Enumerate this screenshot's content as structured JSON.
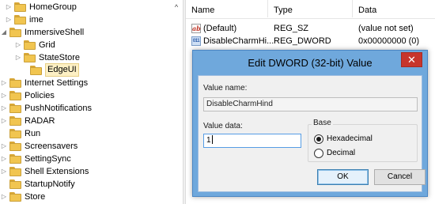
{
  "tree": {
    "items": [
      {
        "label": "HomeGroup",
        "expander": "▷"
      },
      {
        "label": "ime",
        "expander": "▷"
      },
      {
        "label": "ImmersiveShell",
        "expander": "◢"
      },
      {
        "label": "Grid",
        "expander": "▷"
      },
      {
        "label": "StateStore",
        "expander": "▷"
      },
      {
        "label": "EdgeUI",
        "expander": ""
      },
      {
        "label": "Internet Settings",
        "expander": "▷"
      },
      {
        "label": "Policies",
        "expander": "▷"
      },
      {
        "label": "PushNotifications",
        "expander": "▷"
      },
      {
        "label": "RADAR",
        "expander": "▷"
      },
      {
        "label": "Run",
        "expander": ""
      },
      {
        "label": "Screensavers",
        "expander": "▷"
      },
      {
        "label": "SettingSync",
        "expander": "▷"
      },
      {
        "label": "Shell Extensions",
        "expander": "▷"
      },
      {
        "label": "StartupNotify",
        "expander": ""
      },
      {
        "label": "Store",
        "expander": "▷"
      }
    ],
    "selected": "EdgeUI",
    "scroll_up_icon": "^"
  },
  "list": {
    "columns": {
      "name": "Name",
      "type": "Type",
      "data": "Data"
    },
    "rows": [
      {
        "icon": "string-value-icon",
        "icon_text": "ab",
        "name": "(Default)",
        "type": "REG_SZ",
        "data": "(value not set)"
      },
      {
        "icon": "dword-value-icon",
        "icon_text": "011",
        "name": "DisableCharmHi...",
        "type": "REG_DWORD",
        "data": "0x00000000 (0)"
      }
    ]
  },
  "dialog": {
    "title": "Edit DWORD (32-bit) Value",
    "close_glyph": "✕",
    "value_name_label": "Value name:",
    "value_name": "DisableCharmHind",
    "value_data_label": "Value data:",
    "value_data": "1",
    "base_label": "Base",
    "base_options": [
      {
        "label": "Hexadecimal",
        "selected": true
      },
      {
        "label": "Decimal",
        "selected": false
      }
    ],
    "ok_label": "OK",
    "cancel_label": "Cancel"
  },
  "colors": {
    "dialog_frame": "#6fa8dc",
    "close_button": "#c7352c",
    "folder": "#f1c550",
    "selection": "#fdf0c4"
  }
}
